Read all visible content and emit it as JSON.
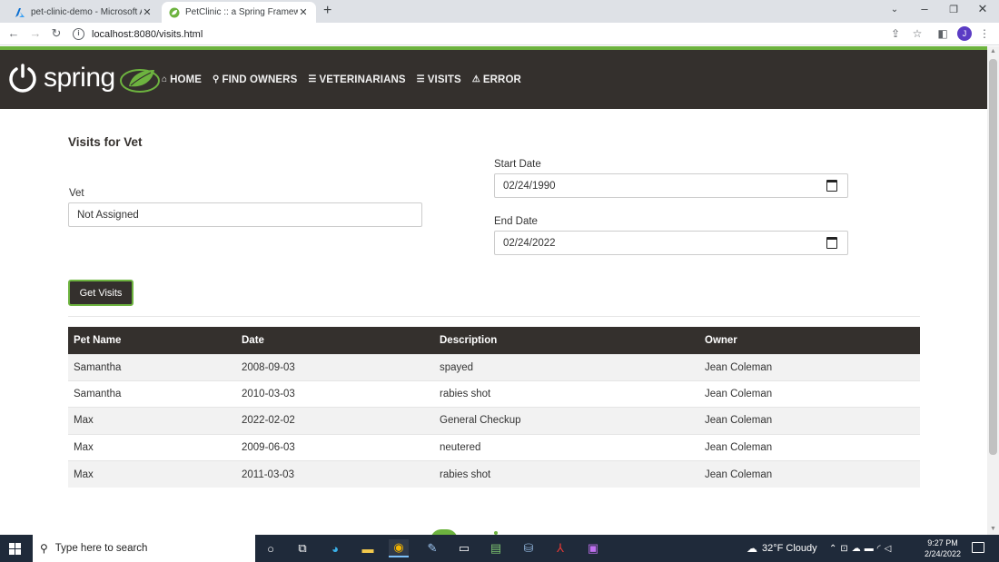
{
  "browser": {
    "tabs": [
      {
        "title": "pet-clinic-demo - Microsoft Azure",
        "active": false
      },
      {
        "title": "PetClinic :: a Spring Framework demonstration",
        "active": true
      }
    ],
    "url": "localhost:8080/visits.html",
    "profile_initial": "J"
  },
  "site": {
    "logo_text": "spring",
    "nav": [
      {
        "label": "HOME",
        "icon": "home-icon"
      },
      {
        "label": "FIND OWNERS",
        "icon": "search-icon"
      },
      {
        "label": "VETERINARIANS",
        "icon": "list-icon"
      },
      {
        "label": "VISITS",
        "icon": "list-icon"
      },
      {
        "label": "ERROR",
        "icon": "warning-icon"
      }
    ],
    "colors": {
      "brand_dark": "#34302d",
      "brand_green": "#6db33f"
    }
  },
  "page": {
    "heading": "Visits for Vet",
    "vet_label": "Vet",
    "vet_value": "Not Assigned",
    "start_date_label": "Start Date",
    "start_date_value": "02/24/1990",
    "end_date_label": "End Date",
    "end_date_value": "02/24/2022",
    "get_visits_label": "Get Visits",
    "table": {
      "headers": [
        "Pet Name",
        "Date",
        "Description",
        "Owner"
      ],
      "rows": [
        [
          "Samantha",
          "2008-09-03",
          "spayed",
          "Jean Coleman"
        ],
        [
          "Samantha",
          "2010-03-03",
          "rabies shot",
          "Jean Coleman"
        ],
        [
          "Max",
          "2022-02-02",
          "General Checkup",
          "Jean Coleman"
        ],
        [
          "Max",
          "2009-06-03",
          "neutered",
          "Jean Coleman"
        ],
        [
          "Max",
          "2011-03-03",
          "rabies shot",
          "Jean Coleman"
        ]
      ]
    }
  },
  "taskbar": {
    "search_placeholder": "Type here to search",
    "weather": "32°F  Cloudy",
    "time": "9:27 PM",
    "date": "2/24/2022"
  }
}
